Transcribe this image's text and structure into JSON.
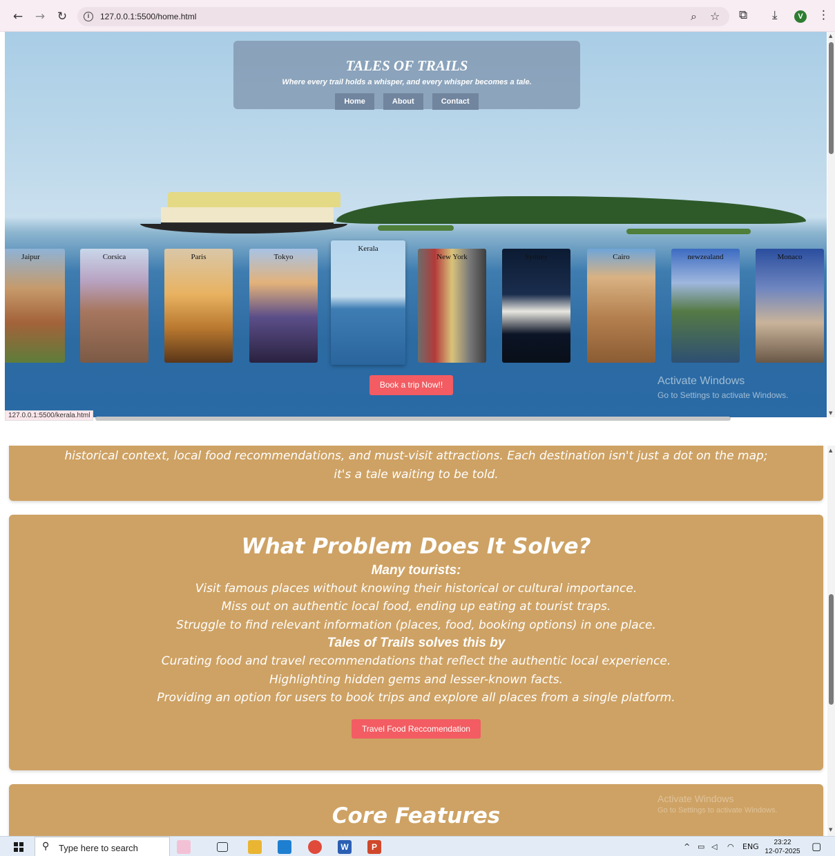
{
  "browser": {
    "url": "127.0.0.1:5500/home.html",
    "profile_initial": "V",
    "icons": [
      "back-icon",
      "forward-icon",
      "reload-icon",
      "info-icon",
      "zoom-icon",
      "star-icon",
      "extensions-icon",
      "download-icon",
      "menu-icon"
    ]
  },
  "hero": {
    "title": "TALES OF TRAILS",
    "subtitle": "Where every trail holds a whisper, and every whisper becomes a tale.",
    "nav": [
      "Home",
      "About",
      "Contact"
    ]
  },
  "destinations": [
    "Jaipur",
    "Corsica",
    "Paris",
    "Tokyo",
    "Kerala",
    "New York",
    "Sydney",
    "Cairo",
    "newzealand",
    "Monaco"
  ],
  "book_button": "Book a trip Now!!",
  "status_url": "127.0.0.1:5500/kerala.html",
  "activate_windows": {
    "title": "Activate Windows",
    "subtitle": "Go to Settings to activate Windows."
  },
  "about_panel": {
    "lines": [
      "historical context, local food recommendations, and must-visit attractions. Each destination isn't just a dot on the map;",
      "it's a tale waiting to be told."
    ]
  },
  "problem_panel": {
    "title": "What Problem Does It Solve?",
    "heading1": "Many tourists:",
    "points1": [
      "Visit famous places without knowing their historical or cultural importance.",
      "Miss out on authentic local food, ending up eating at tourist traps.",
      "Struggle to find relevant information (places, food, booking options) in one place."
    ],
    "heading2": "Tales of Trails solves this by",
    "points2": [
      "Curating food and travel recommendations that reflect the authentic local experience.",
      "Highlighting hidden gems and lesser-known facts.",
      "Providing an option for users to book trips and explore all places from a single platform."
    ],
    "button": "Travel Food Reccomendation"
  },
  "features_panel": {
    "title": "Core Features"
  },
  "taskbar": {
    "search_placeholder": "Type here to search",
    "language": "ENG",
    "time": "23:22",
    "date": "12-07-2025",
    "apps": [
      {
        "name": "task-view",
        "label": ""
      },
      {
        "name": "file-explorer",
        "label": ""
      },
      {
        "name": "vscode",
        "label": ""
      },
      {
        "name": "chrome",
        "label": ""
      },
      {
        "name": "word",
        "label": "W"
      },
      {
        "name": "powerpoint",
        "label": "P"
      }
    ]
  },
  "colors": {
    "panel": "#cea264",
    "accent_button": "#f25c62",
    "hero_box": "#7d91aa"
  }
}
